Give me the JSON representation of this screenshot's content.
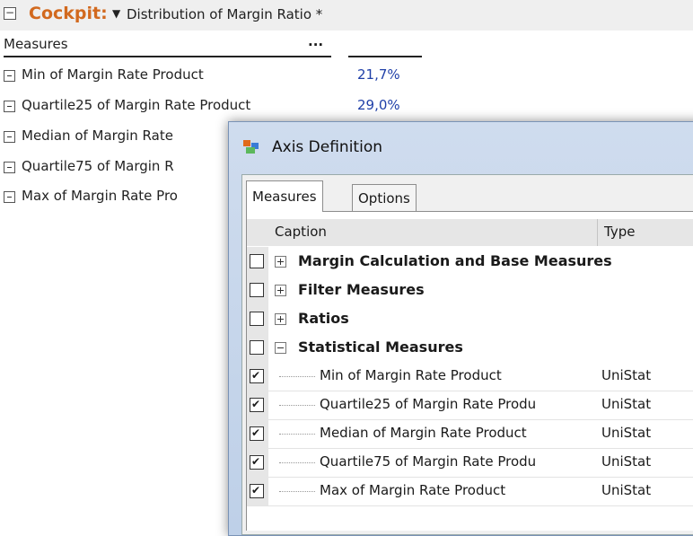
{
  "top": {
    "cockpit_label": "Cockpit:",
    "dropdown_icon": "triangle-down-icon",
    "title": "Distribution of Margin Ratio *"
  },
  "measures": {
    "header": "Measures",
    "ellipsis": "...",
    "rows": [
      {
        "label": "Min of Margin Rate Product",
        "value": "21,7%"
      },
      {
        "label": "Quartile25 of Margin Rate Product",
        "value": "29,0%"
      },
      {
        "label": "Median of Margin Rate",
        "value": ""
      },
      {
        "label": "Quartile75 of Margin R",
        "value": ""
      },
      {
        "label": "Max of Margin Rate Pro",
        "value": ""
      }
    ]
  },
  "dialog": {
    "title": "Axis Definition",
    "tabs": [
      "Measures",
      "Options"
    ],
    "columns": {
      "caption": "Caption",
      "type": "Type"
    },
    "groups": [
      {
        "label": "Margin Calculation and Base Measures",
        "expanded": false
      },
      {
        "label": "Filter Measures",
        "expanded": false
      },
      {
        "label": "Ratios",
        "expanded": false
      },
      {
        "label": "Statistical Measures",
        "expanded": true
      }
    ],
    "items": [
      {
        "caption": "Min of Margin Rate Product",
        "type": "UniStat",
        "checked": true
      },
      {
        "caption": "Quartile25 of Margin Rate Produ",
        "type": "UniStat",
        "checked": true
      },
      {
        "caption": "Median of Margin Rate Product",
        "type": "UniStat",
        "checked": true
      },
      {
        "caption": "Quartile75 of Margin Rate Produ",
        "type": "UniStat",
        "checked": true
      },
      {
        "caption": "Max of Margin Rate Product",
        "type": "UniStat",
        "checked": true
      }
    ]
  }
}
